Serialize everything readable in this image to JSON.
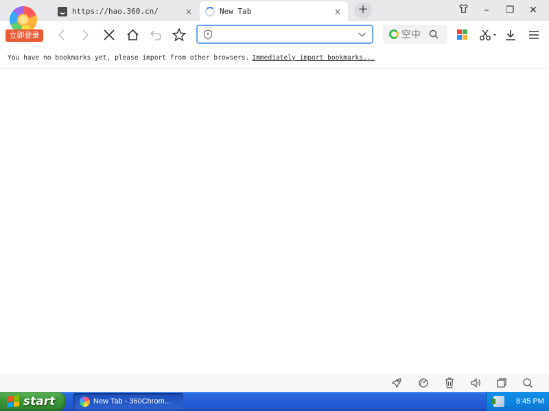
{
  "browser": {
    "login_badge": "立即登录",
    "tabs": [
      {
        "title": "https://hao.360.cn/",
        "close": "×",
        "active": false
      },
      {
        "title": "New Tab",
        "close": "×",
        "active": true
      }
    ],
    "new_tab_symbol": "+",
    "window_controls": {
      "minimize": "–",
      "maximize": "❐",
      "close": "✕"
    }
  },
  "toolbar": {
    "address_value": "",
    "search_placeholder": "空中客车",
    "search_visible_text": "空中"
  },
  "bookmarks_bar": {
    "message": "You have no bookmarks yet, please import from other browsers.",
    "import_link": "Immediately import bookmarks..."
  },
  "taskbar": {
    "start_label": "start",
    "task_item_label": "New Tab - 360Chrom...",
    "clock": "8:45 PM"
  },
  "colors": {
    "address_border": "#6da3f2",
    "login_badge_bg": "#e95a35",
    "taskbar_blue": "#245ed6",
    "start_green": "#3c9a3a"
  }
}
